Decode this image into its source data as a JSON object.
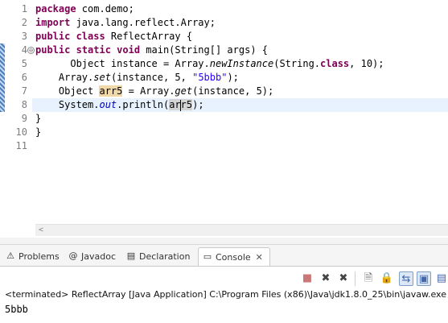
{
  "editor": {
    "line_numbers": [
      "1",
      "2",
      "3",
      "4",
      "5",
      "6",
      "7",
      "8",
      "9",
      "10",
      "11"
    ],
    "lines": [
      [
        {
          "t": "package",
          "c": "kw"
        },
        {
          "t": " com.demo;"
        }
      ],
      [
        {
          "t": "import",
          "c": "kw"
        },
        {
          "t": " java.lang.reflect.Array;"
        }
      ],
      [
        {
          "t": "public class",
          "c": "kw"
        },
        {
          "t": " ReflectArray {"
        }
      ],
      [
        {
          "t": "public static void",
          "c": "kw"
        },
        {
          "t": " main(String[] args) {"
        }
      ],
      [
        {
          "t": "      Object instance = Array."
        },
        {
          "t": "newInstance",
          "c": "ital"
        },
        {
          "t": "(String."
        },
        {
          "t": "class",
          "c": "kw"
        },
        {
          "t": ", 10);"
        }
      ],
      [
        {
          "t": "    Array."
        },
        {
          "t": "set",
          "c": "ital"
        },
        {
          "t": "(instance, 5, "
        },
        {
          "t": "\"5bbb\"",
          "c": "str"
        },
        {
          "t": ");"
        }
      ],
      [
        {
          "t": "    Object "
        },
        {
          "t": "arr5",
          "c": "occ-write"
        },
        {
          "t": " = Array."
        },
        {
          "t": "get",
          "c": "ital"
        },
        {
          "t": "(instance, 5);"
        }
      ],
      [
        {
          "t": "    System."
        },
        {
          "t": "out",
          "c": "fld ital"
        },
        {
          "t": ".println("
        },
        {
          "t": "ar",
          "c": "occ"
        },
        {
          "t": "",
          "c": "caret"
        },
        {
          "t": "r5",
          "c": "occ"
        },
        {
          "t": ");"
        }
      ],
      [
        {
          "t": "}"
        }
      ],
      [
        {
          "t": "}"
        }
      ],
      [
        {
          "t": ""
        }
      ]
    ],
    "current_line_index": 7,
    "fold_marker": "⊖",
    "scroll_left_glyph": "<"
  },
  "tabs": [
    {
      "label": "Problems",
      "icon": "problems-icon",
      "glyph": "⚠"
    },
    {
      "label": "Javadoc",
      "icon": "javadoc-icon",
      "glyph": "@"
    },
    {
      "label": "Declaration",
      "icon": "declaration-icon",
      "glyph": "▤"
    },
    {
      "label": "Console",
      "icon": "console-icon",
      "glyph": "▭",
      "active": true
    }
  ],
  "tab_close_glyph": "✕",
  "console": {
    "header": "<terminated> ReflectArray [Java Application] C:\\Program Files (x86)\\Java\\jdk1.8.0_25\\bin\\javaw.exe",
    "output": "5bbb"
  },
  "console_toolbar": [
    {
      "name": "terminate-icon",
      "glyph": "■"
    },
    {
      "name": "remove-launch-icon",
      "glyph": "✖"
    },
    {
      "name": "remove-all-launches-icon",
      "glyph": "✖"
    },
    {
      "name": "clear-console-icon",
      "glyph": "🗎"
    },
    {
      "name": "scroll-lock-icon",
      "glyph": "🔒"
    },
    {
      "name": "word-wrap-icon",
      "glyph": "⇆"
    },
    {
      "name": "show-on-output-icon",
      "glyph": "▣"
    },
    {
      "name": "display-console-icon",
      "glyph": "▤"
    },
    {
      "name": "pin-console-icon",
      "glyph": "⚲"
    }
  ],
  "colors": {
    "keyword": "#7f0055",
    "string": "#2a00ff",
    "field": "#0000c0",
    "current_line": "#e8f2fe",
    "change_ruler": "#4b7fbf"
  }
}
